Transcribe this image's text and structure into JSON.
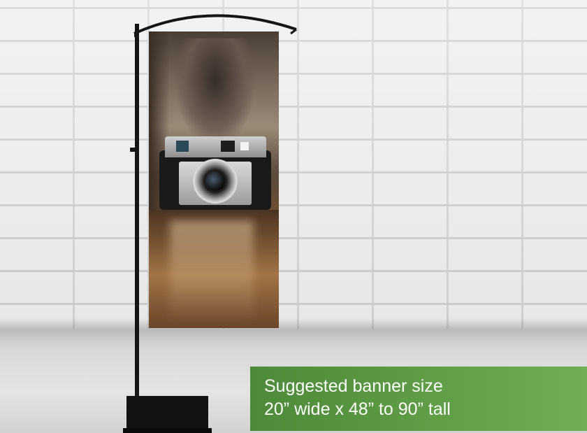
{
  "notice": {
    "line1": "Suggested banner size",
    "line2": "20” wide x 48” to 90” tall",
    "background": "#5c9a45",
    "text_color": "#ffffff"
  },
  "scene": {
    "wall_color": "#ececec",
    "stand_color": "#151515"
  },
  "icons": {
    "camera": "camera-icon"
  }
}
